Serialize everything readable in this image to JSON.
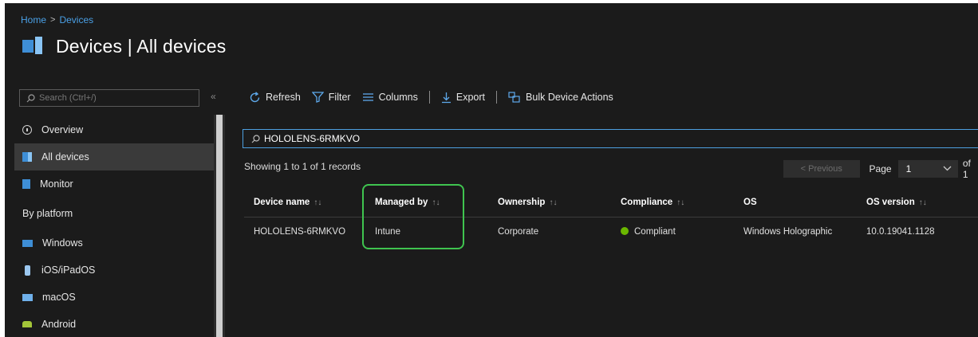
{
  "breadcrumb": {
    "home": "Home",
    "separator": ">",
    "current": "Devices"
  },
  "header": {
    "title": "Devices | All devices",
    "icon": "devices-icon"
  },
  "sidebar": {
    "search_placeholder": "Search (Ctrl+/)",
    "collapse_glyph": "«",
    "items": [
      {
        "label": "Overview",
        "icon": "info-icon"
      },
      {
        "label": "All devices",
        "icon": "devices-icon",
        "active": true
      },
      {
        "label": "Monitor",
        "icon": "monitor-icon"
      }
    ],
    "section_label": "By platform",
    "platforms": [
      {
        "label": "Windows",
        "icon": "windows-icon"
      },
      {
        "label": "iOS/iPadOS",
        "icon": "ios-icon"
      },
      {
        "label": "macOS",
        "icon": "macos-icon"
      },
      {
        "label": "Android",
        "icon": "android-icon"
      }
    ]
  },
  "toolbar": {
    "refresh": "Refresh",
    "filter": "Filter",
    "columns": "Columns",
    "export": "Export",
    "bulk_actions": "Bulk Device Actions"
  },
  "filter": {
    "value": "HOLOLENS-6RMKVO"
  },
  "records": {
    "summary": "Showing 1 to 1 of 1 records"
  },
  "pager": {
    "previous": "< Previous",
    "page_label": "Page",
    "page_value": "1",
    "of_label": "of 1"
  },
  "table": {
    "sort_glyph": "↑↓",
    "headers": [
      "Device name",
      "Managed by",
      "Ownership",
      "Compliance",
      "OS",
      "OS version"
    ],
    "rows": [
      {
        "device_name": "HOLOLENS-6RMKVO",
        "managed_by": "Intune",
        "ownership": "Corporate",
        "compliance": "Compliant",
        "os": "Windows Holographic",
        "os_version": "10.0.19041.1128"
      }
    ]
  },
  "colors": {
    "background": "#1b1b1b",
    "accent": "#4aa0e6",
    "highlight": "#3fc44f",
    "compliant": "#6bb700"
  }
}
